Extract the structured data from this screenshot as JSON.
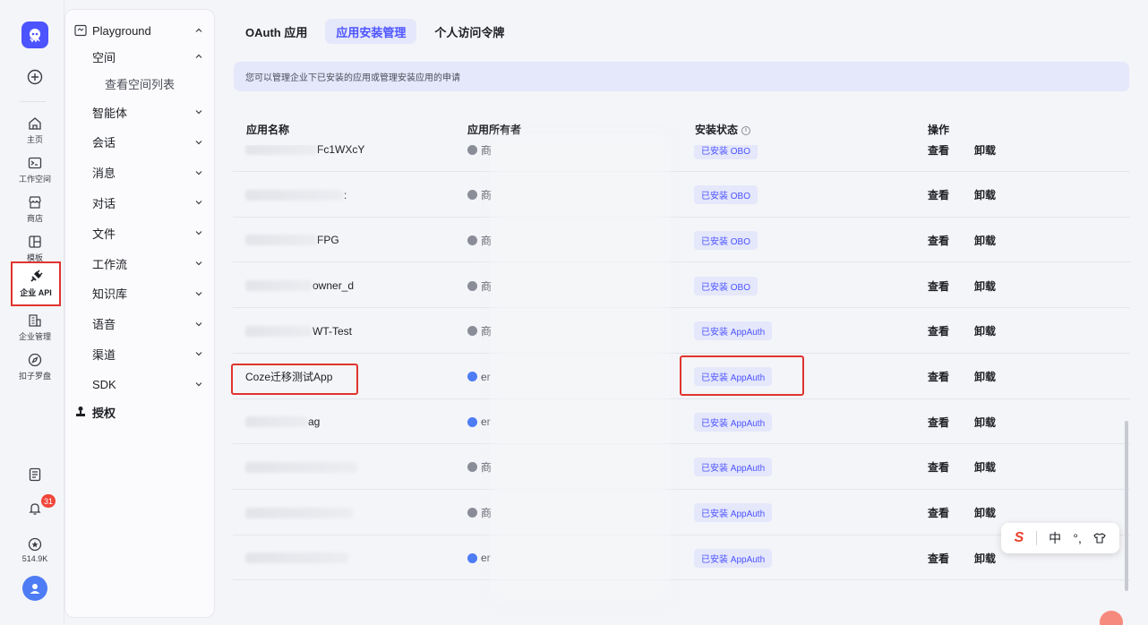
{
  "rail": {
    "items": [
      {
        "label": "主页",
        "icon": "home-icon"
      },
      {
        "label": "工作空间",
        "icon": "terminal-icon"
      },
      {
        "label": "商店",
        "icon": "store-icon"
      },
      {
        "label": "模板",
        "icon": "template-icon"
      },
      {
        "label": "企业 API",
        "icon": "api-plug-icon"
      },
      {
        "label": "企业管理",
        "icon": "building-icon"
      },
      {
        "label": "扣子罗盘",
        "icon": "compass-icon"
      }
    ],
    "notification_count": "31",
    "star_count": "514.9K"
  },
  "nav": {
    "playground": "Playground",
    "space": "空间",
    "space_list": "查看空间列表",
    "items": [
      "智能体",
      "会话",
      "消息",
      "对话",
      "文件",
      "工作流",
      "知识库",
      "语音",
      "渠道",
      "SDK"
    ],
    "auth": "授权"
  },
  "tabs": [
    "OAuth 应用",
    "应用安装管理",
    "个人访问令牌"
  ],
  "notice": "您可以管理企业下已安装的应用或管理安装应用的申请",
  "table": {
    "headers": [
      "应用名称",
      "应用所有者",
      "安装状态",
      "操作"
    ],
    "view": "查看",
    "uninstall": "卸载",
    "rows": [
      {
        "name": "Fc1WXcY",
        "owner": "商",
        "status": "已安装 OBO"
      },
      {
        "name": ":",
        "owner": "商",
        "status": "已安装 OBO"
      },
      {
        "name": "FPG",
        "owner": "商",
        "status": "已安装 OBO"
      },
      {
        "name": "owner_d",
        "owner": "商",
        "status": "已安装 OBO"
      },
      {
        "name": "WT-Test",
        "owner": "商",
        "status": "已安装 AppAuth"
      },
      {
        "name": "Coze迁移测试App",
        "owner": "er",
        "status": "已安装 AppAuth"
      },
      {
        "name": "ag",
        "owner": "er",
        "status": "已安装 AppAuth"
      },
      {
        "name": "",
        "owner": "商",
        "status": "已安装 AppAuth"
      },
      {
        "name": "",
        "owner": "商",
        "status": "已安装 AppAuth"
      },
      {
        "name": "",
        "owner": "er",
        "status": "已安装 AppAuth"
      }
    ]
  },
  "ime": {
    "lang": "中",
    "punct": "°,"
  }
}
